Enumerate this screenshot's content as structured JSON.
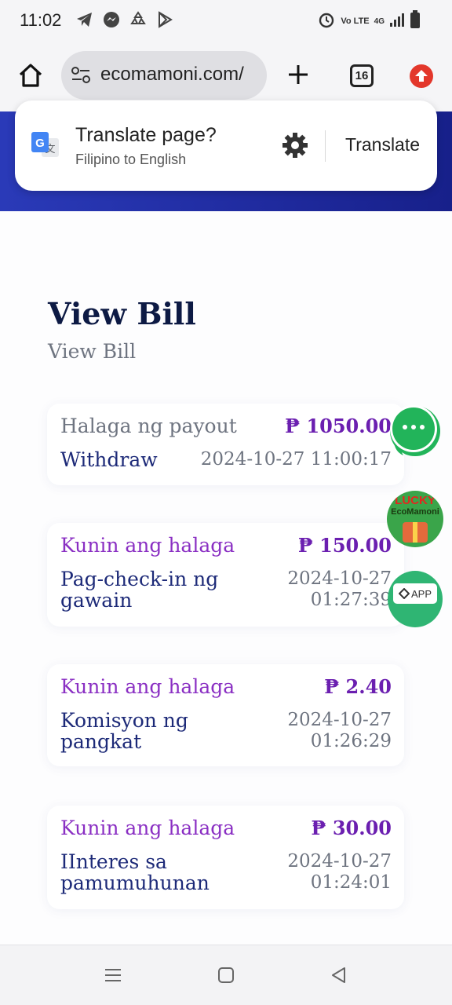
{
  "status_bar": {
    "time": "11:02",
    "volte": "Vo LTE",
    "network": "4G",
    "icons": [
      "telegram-icon",
      "messenger-icon",
      "recycle-icon",
      "play-store-icon",
      "alarm-icon",
      "signal-icon",
      "battery-icon"
    ]
  },
  "browser": {
    "url": "ecomamoni.com/",
    "tab_count": "16"
  },
  "translate_popup": {
    "title": "Translate page?",
    "subtitle": "Filipino to English",
    "action_label": "Translate"
  },
  "page": {
    "title": "View Bill",
    "subtitle": "View Bill"
  },
  "bills": [
    {
      "label": "Halaga ng payout",
      "amount": "₱ 1050.00",
      "type": "Withdraw",
      "date": "2024-10-27 11:00:17",
      "label_color": "#6e7480"
    },
    {
      "label": "Kunin ang halaga",
      "amount": "₱ 150.00",
      "type": "Pag-check-in ng gawain",
      "date": "2024-10-27 01:27:39",
      "label_color": "#8a2fc3"
    },
    {
      "label": "Kunin ang halaga",
      "amount": "₱ 2.40",
      "type": "Komisyon ng pangkat",
      "date": "2024-10-27 01:26:29",
      "label_color": "#8a2fc3"
    },
    {
      "label": "Kunin ang halaga",
      "amount": "₱ 30.00",
      "type": "IInteres sa pamumuhunan",
      "date": "2024-10-27 01:24:01",
      "label_color": "#8a2fc3"
    }
  ],
  "floating": {
    "lucky_top": "LUCKY",
    "lucky_brand": "EcoMamoni",
    "app_label": "APP"
  },
  "colors": {
    "hero": "#1f2a9e",
    "amount": "#6b1fb0",
    "chat_green": "#22b45a",
    "app_green": "#2fb573"
  }
}
